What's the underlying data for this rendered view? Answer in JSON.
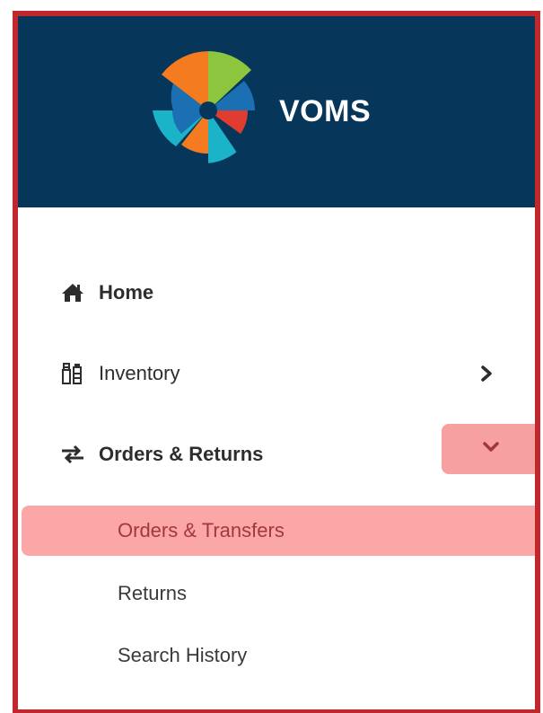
{
  "brand": {
    "name": "VOMS"
  },
  "nav": {
    "home": {
      "label": "Home",
      "icon": "home-icon"
    },
    "inventory": {
      "label": "Inventory",
      "icon": "vaccine-vials-icon"
    },
    "orders_returns": {
      "label": "Orders & Returns",
      "icon": "transfer-arrows-icon",
      "expanded": true
    }
  },
  "submenu": {
    "items": [
      {
        "label": "Orders & Transfers",
        "active": true
      },
      {
        "label": "Returns",
        "active": false
      },
      {
        "label": "Search History",
        "active": false
      }
    ]
  },
  "colors": {
    "header_bg": "#063659",
    "frame_border": "#c0282d",
    "active_bg": "#fca7a7",
    "active_text": "#a3383c",
    "text": "#2d2d2d"
  }
}
